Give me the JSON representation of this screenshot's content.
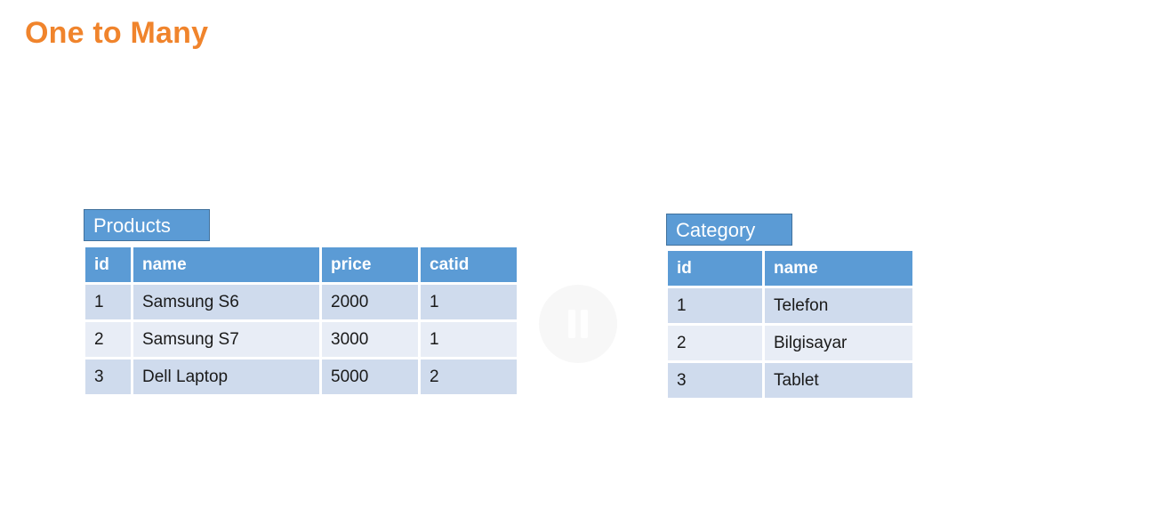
{
  "slide": {
    "title": "One to Many"
  },
  "products": {
    "caption": "Products",
    "headers": [
      "id",
      "name",
      "price",
      "catid"
    ],
    "rows": [
      [
        "1",
        "Samsung S6",
        "2000",
        "1"
      ],
      [
        "2",
        "Samsung S7",
        "3000",
        "1"
      ],
      [
        "3",
        "Dell Laptop",
        "5000",
        "2"
      ]
    ]
  },
  "category": {
    "caption": "Category",
    "headers": [
      "id",
      "name"
    ],
    "rows": [
      [
        "1",
        "Telefon"
      ],
      [
        "2",
        "Bilgisayar"
      ],
      [
        "3",
        "Tablet"
      ]
    ]
  },
  "colors": {
    "title": "#f0842c",
    "header": "#5b9bd5",
    "row_odd": "#cfdbed",
    "row_even": "#e8edf6"
  },
  "overlay": {
    "icon": "pause-icon"
  }
}
